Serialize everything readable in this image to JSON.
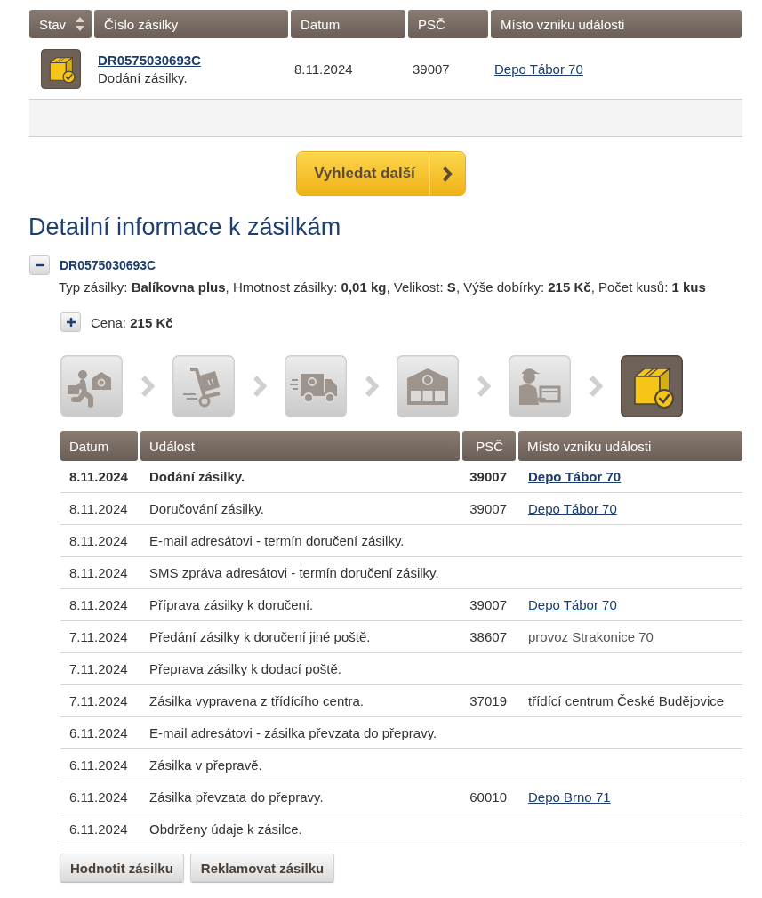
{
  "results_table": {
    "columns": [
      {
        "label": "Stav",
        "sortable": true
      },
      {
        "label": "Číslo zásilky",
        "sortable": false
      },
      {
        "label": "Datum",
        "sortable": false
      },
      {
        "label": "PSČ",
        "sortable": false
      },
      {
        "label": "Místo vzniku události",
        "sortable": false
      }
    ],
    "rows": [
      {
        "kind": "delivered",
        "number": "DR0575030693C",
        "event": "Dodání zásilky.",
        "date": "8.11.2024",
        "zip": "39007",
        "place": {
          "text": "Depo Tábor 70",
          "kind": "link"
        }
      }
    ]
  },
  "search_more_button": {
    "label": "Vyhledat další"
  },
  "details": {
    "title": "Detailní informace k zásilkám",
    "parcels": [
      {
        "number": "DR0575030693C",
        "expanded": true,
        "info": "Typ zásilky: **Balíkovna plus**, Hmotnost zásilky: **0,01 kg**, Velikost: **S**, Výše dobírky: **215 Kč**, Počet kusů: **1 kus**",
        "price": {
          "text": "Cena: **215 Kč**",
          "expanded": false
        },
        "steps": [
          {
            "kind": "handover",
            "current": false
          },
          {
            "kind": "cart",
            "current": false
          },
          {
            "kind": "truck",
            "current": false
          },
          {
            "kind": "depot",
            "current": false
          },
          {
            "kind": "courier",
            "current": false
          },
          {
            "kind": "delivered",
            "current": true
          }
        ],
        "history": {
          "columns": [
            "Datum",
            "Událost",
            "PSČ",
            "Místo vzniku události"
          ],
          "rows": [
            {
              "date": "8.11.2024",
              "event": "Dodání zásilky.",
              "zip": "39007",
              "place": {
                "text": "Depo Tábor 70",
                "kind": "link"
              },
              "latest": true
            },
            {
              "date": "8.11.2024",
              "event": "Doručování zásilky.",
              "zip": "39007",
              "place": {
                "text": "Depo Tábor 70",
                "kind": "link"
              },
              "latest": false
            },
            {
              "date": "8.11.2024",
              "event": "E-mail adresátovi - termín doručení zásilky.",
              "latest": false
            },
            {
              "date": "8.11.2024",
              "event": "SMS zpráva adresátovi - termín doručení zásilky.",
              "latest": false
            },
            {
              "date": "8.11.2024",
              "event": "Příprava zásilky k doručení.",
              "zip": "39007",
              "place": {
                "text": "Depo Tábor 70",
                "kind": "link"
              },
              "latest": false
            },
            {
              "date": "7.11.2024",
              "event": "Předání zásilky k doručení jiné poště.",
              "zip": "38607",
              "place": {
                "text": "provoz Strakonice 70",
                "kind": "visited"
              },
              "latest": false
            },
            {
              "date": "7.11.2024",
              "event": "Přeprava zásilky k dodací poště.",
              "latest": false
            },
            {
              "date": "7.11.2024",
              "event": "Zásilka vypravena z třídícího centra.",
              "zip": "37019",
              "place": {
                "text": "třídící centrum České Budějovice",
                "kind": "text"
              },
              "latest": false
            },
            {
              "date": "6.11.2024",
              "event": "E-mail adresátovi - zásilka převzata do přepravy.",
              "latest": false
            },
            {
              "date": "6.11.2024",
              "event": "Zásilka v přepravě.",
              "latest": false
            },
            {
              "date": "6.11.2024",
              "event": "Zásilka převzata do přepravy.",
              "zip": "60010",
              "place": {
                "text": "Depo Brno 71",
                "kind": "link"
              },
              "latest": false
            },
            {
              "date": "6.11.2024",
              "event": "Obdrženy údaje k zásilce.",
              "latest": false
            }
          ]
        },
        "actions": [
          "Hodnotit zásilku",
          "Reklamovat zásilku"
        ]
      }
    ]
  }
}
